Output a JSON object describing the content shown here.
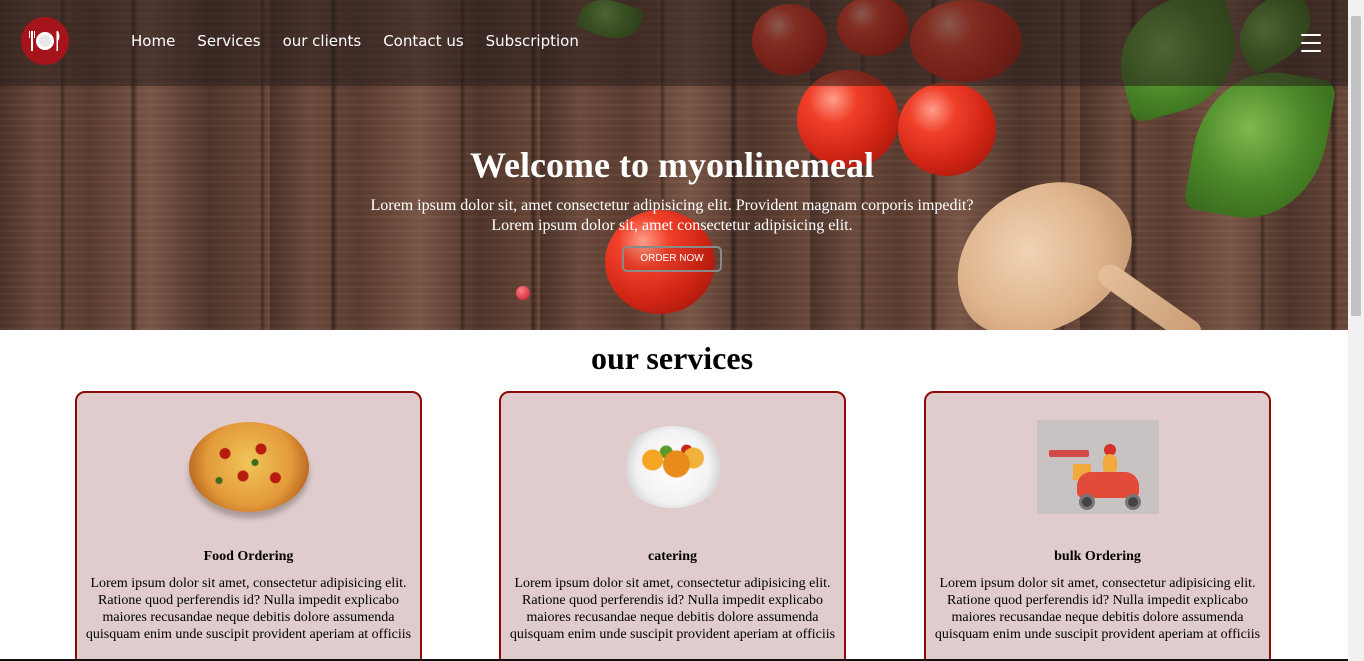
{
  "nav": {
    "logo_icon": "plate-fork-knife-icon",
    "links": [
      "Home",
      "Services",
      "our clients",
      "Contact us",
      "Subscription"
    ],
    "menu_icon": "hamburger-menu-icon"
  },
  "hero": {
    "title": "Welcome to myonlinemeal",
    "line1": "Lorem ipsum dolor sit, amet consectetur adipisicing elit. Provident magnam corporis impedit?",
    "line2": "Lorem ipsum dolor sit, amet consectetur adipisicing elit.",
    "button": "ORDER NOW"
  },
  "services": {
    "title": "our services",
    "cards": [
      {
        "title": "Food Ordering",
        "text": "Lorem ipsum dolor sit amet, consectetur adipisicing elit. Ratione quod perferendis id? Nulla impedit explicabo maiores recusandae neque debitis dolore assumenda quisquam enim unde suscipit provident aperiam at officiis"
      },
      {
        "title": "catering",
        "text": "Lorem ipsum dolor sit amet, consectetur adipisicing elit. Ratione quod perferendis id? Nulla impedit explicabo maiores recusandae neque debitis dolore assumenda quisquam enim unde suscipit provident aperiam at officiis"
      },
      {
        "title": "bulk Ordering",
        "text": "Lorem ipsum dolor sit amet, consectetur adipisicing elit. Ratione quod perferendis id? Nulla impedit explicabo maiores recusandae neque debitis dolore assumenda quisquam enim unde suscipit provident aperiam at officiis"
      }
    ]
  },
  "colors": {
    "accent": "#a5141b",
    "card_bg": "#e0cccc",
    "card_border": "#8d0b0b"
  }
}
